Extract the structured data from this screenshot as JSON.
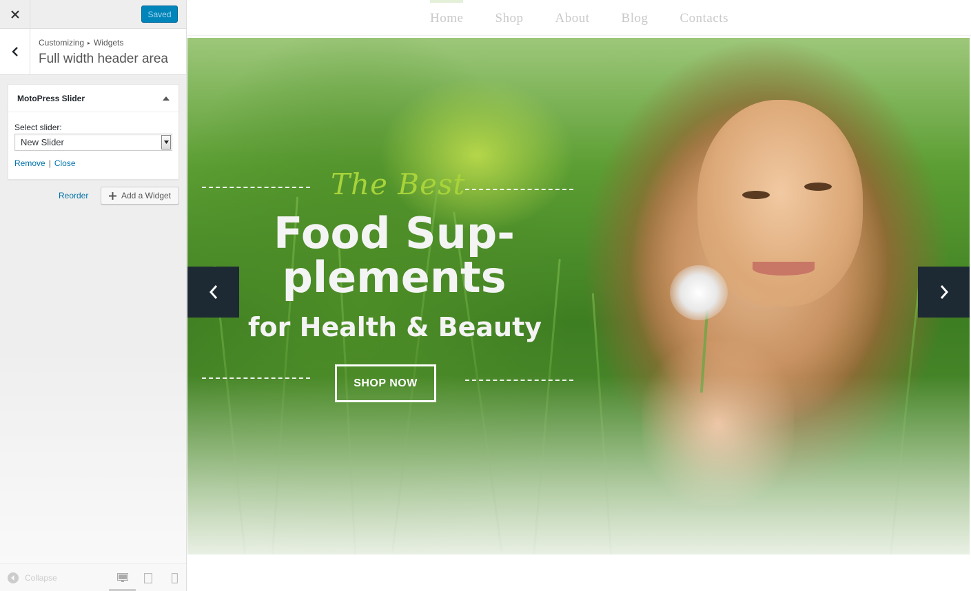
{
  "sidebar": {
    "close_icon": "close-icon",
    "saved_label": "Saved",
    "breadcrumb": {
      "root": "Customizing",
      "sep": "▸",
      "current": "Widgets"
    },
    "section_title": "Full width header area",
    "widget": {
      "title": "MotoPress Slider",
      "select_label": "Select slider:",
      "select_value": "New Slider",
      "remove_label": "Remove",
      "pipe": "|",
      "close_label": "Close"
    },
    "reorder_label": "Reorder",
    "add_widget_label": "Add a Widget",
    "collapse_label": "Collapse"
  },
  "preview": {
    "nav": [
      "Home",
      "Shop",
      "About",
      "Blog",
      "Contacts"
    ],
    "active_nav": "Home",
    "slide": {
      "pretitle": "The Best",
      "headline_line1": "Food Sup-",
      "headline_line2": "plements",
      "subline": "for Health & Beauty",
      "button": "SHOP NOW"
    }
  },
  "colors": {
    "accent": "#0085ba",
    "link": "#0073aa",
    "pretitle": "#a8d43a",
    "arrow_bg": "#1d2a33"
  }
}
